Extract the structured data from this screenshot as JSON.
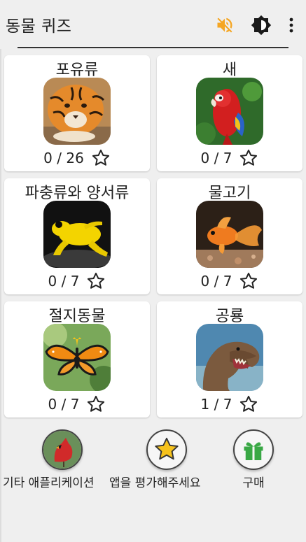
{
  "app": {
    "title": "동물 퀴즈",
    "icons": {
      "mute": "volume-mute-icon",
      "theme": "brightness-icon",
      "more": "more-vert-icon"
    },
    "colors": {
      "accent": "#f5a623",
      "background": "#efefef",
      "card": "#ffffff"
    }
  },
  "categories": [
    {
      "name": "포유류",
      "score": "0 / 26",
      "image": "tiger"
    },
    {
      "name": "새",
      "score": "0 / 7",
      "image": "parrot"
    },
    {
      "name": "파충류와 양서류",
      "score": "0 / 7",
      "image": "yellow-frog"
    },
    {
      "name": "물고기",
      "score": "0 / 7",
      "image": "goldfish"
    },
    {
      "name": "절지동물",
      "score": "0 / 7",
      "image": "butterfly"
    },
    {
      "name": "공룡",
      "score": "1 / 7",
      "image": "dinosaur"
    }
  ],
  "bottom": {
    "other_apps": {
      "label": "기타 애플리케이션",
      "icon": "cardinal-bird-icon"
    },
    "rate": {
      "label": "앱을 평가해주세요",
      "icon": "star-icon"
    },
    "buy": {
      "label": "구매",
      "icon": "gift-icon"
    }
  }
}
